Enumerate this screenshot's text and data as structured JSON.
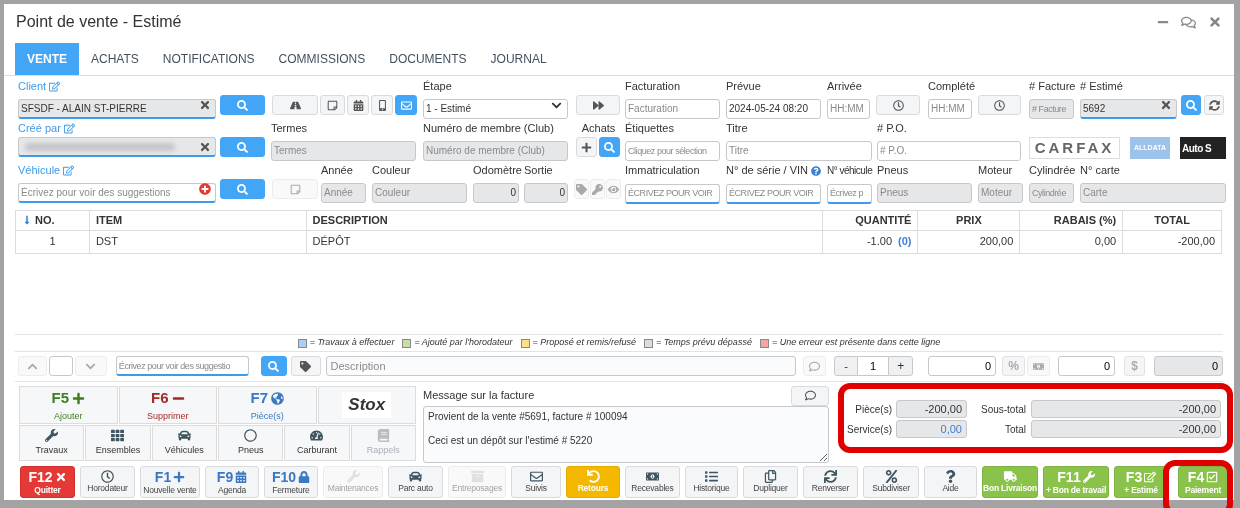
{
  "window": {
    "title": "Point de vente - Estimé"
  },
  "tabs": [
    {
      "label": "VENTE",
      "selected": true
    },
    {
      "label": "ACHATS",
      "selected": false
    },
    {
      "label": "NOTIFICATIONS",
      "selected": false
    },
    {
      "label": "COMMISSIONS",
      "selected": false
    },
    {
      "label": "DOCUMENTS",
      "selected": false
    },
    {
      "label": "JOURNAL",
      "selected": false
    }
  ],
  "client_buttons": [
    {
      "selected": false
    },
    {
      "selected": false
    },
    {
      "selected": false
    },
    {
      "selected": false
    },
    {
      "selected": true
    }
  ],
  "fields": {
    "client": {
      "label": "Client",
      "value": "SFSDF - ALAIN ST-PIERRE",
      "disabled": true
    },
    "etape": {
      "label": "Étape",
      "value": "1 - Estimé",
      "disabled": false
    },
    "facturation": {
      "label": "Facturation",
      "placeholder": "Facturation",
      "disabled": false
    },
    "prevue": {
      "label": "Prévue",
      "value": "2024-05-24 08:20",
      "disabled": false
    },
    "arrivee": {
      "label": "Arrivée",
      "placeholder": "HH:MM",
      "disabled": false
    },
    "complete": {
      "label": "Complété",
      "placeholder": "HH:MM",
      "disabled": false
    },
    "facture": {
      "label": "# Facture",
      "placeholder": "# Facture",
      "disabled": true
    },
    "estime": {
      "label": "# Estimé",
      "value": "5692",
      "disabled": true
    },
    "cree_par": {
      "label": "Créé par",
      "disabled": true
    },
    "termes": {
      "label": "Termes",
      "placeholder": "Termes",
      "disabled": true
    },
    "membre": {
      "label": "Numéro de membre (Club)",
      "placeholder": "Numéro de membre (Club)",
      "disabled": true
    },
    "etiquettes": {
      "label": "Étiquettes",
      "placeholder": "Cliquez pour sélection",
      "disabled": false
    },
    "titre": {
      "label": "Titre",
      "placeholder": "Titre",
      "disabled": false
    },
    "po": {
      "label": "# P.O.",
      "placeholder": "# P.O.",
      "disabled": false
    },
    "vehicule": {
      "label": "Véhicule",
      "placeholder": "Écrivez pour voir des suggestions",
      "disabled": false
    },
    "annee": {
      "label": "Année",
      "placeholder": "Année",
      "disabled": true
    },
    "couleur": {
      "label": "Couleur",
      "placeholder": "Couleur",
      "disabled": true
    },
    "odometre": {
      "label": "Odomètre",
      "value": "0",
      "disabled": true
    },
    "sortie": {
      "label": "Sortie",
      "value": "0",
      "disabled": true
    },
    "immatriculation": {
      "label": "Immatriculation",
      "placeholder": "ÉCRIVEZ POUR VOIR",
      "disabled": false
    },
    "vin": {
      "label": "N° de série / VIN",
      "placeholder": "ÉCRIVEZ POUR VOIR",
      "disabled": false
    },
    "no_vehicule": {
      "label": "N° véhicule",
      "placeholder": "Écrivez p",
      "disabled": false
    },
    "pneus": {
      "label": "Pneus",
      "placeholder": "Pneus",
      "disabled": true
    },
    "moteur": {
      "label": "Moteur",
      "placeholder": "Moteur",
      "disabled": true
    },
    "cylindree": {
      "label": "Cylindrée",
      "placeholder": "Cylindrée",
      "disabled": true
    },
    "carte": {
      "label": "N° carte",
      "placeholder": "Carte",
      "disabled": true
    }
  },
  "achats_label": "Achats",
  "logos": [
    "CARFAX",
    "ALLDATA",
    "Auto S"
  ],
  "table": {
    "columns": [
      "NO.",
      "ITEM",
      "DESCRIPTION",
      "QUANTITÉ",
      "PRIX",
      "RABAIS (%)",
      "TOTAL"
    ],
    "rows": [
      {
        "no": "1",
        "item": "DST",
        "description": "DÉPÔT",
        "quantity": "-1.00",
        "count": "(0)",
        "price": "200,00",
        "discount": "0,00",
        "total": "-200,00"
      }
    ]
  },
  "legend": [
    {
      "label": "= Travaux à effectuer",
      "color": "#a9d0f5"
    },
    {
      "label": "= Ajouté par l'horodateur",
      "color": "#c5e0a5"
    },
    {
      "label": "= Proposé et remis/refusé",
      "color": "#fbe08a"
    },
    {
      "label": "= Temps prévu dépassé",
      "color": "#dcdcdc"
    },
    {
      "label": "= Une erreur est présente dans cette ligne",
      "color": "#f4a6a6"
    }
  ],
  "entry": {
    "search_placeholder": "Écrivez pour voir des suggestio",
    "description_placeholder": "Description",
    "quantity": "1",
    "minus": "-",
    "plus": "+",
    "percent_value": "0",
    "percent_sign": "%",
    "amount_value": "0",
    "dollar_sign": "$",
    "price_value": "0"
  },
  "actions": [
    {
      "key": "F5",
      "label": "Ajouter",
      "kind": "add"
    },
    {
      "key": "F6",
      "label": "Supprimer",
      "kind": "remove"
    },
    {
      "key": "F7",
      "label": "Pièce(s)",
      "kind": "parts"
    },
    {
      "label": "Stox",
      "kind": "logo"
    }
  ],
  "categories": [
    {
      "label": "Travaux",
      "disabled": false
    },
    {
      "label": "Ensembles",
      "disabled": false
    },
    {
      "label": "Véhicules",
      "disabled": false
    },
    {
      "label": "Pneus",
      "disabled": false
    },
    {
      "label": "Carburant",
      "disabled": false
    },
    {
      "label": "Rappels",
      "disabled": true
    }
  ],
  "message": {
    "label": "Message sur la facture",
    "text": "Provient de la vente #5691, facture # 100094\n\nCeci est un dépôt sur l'estimé # 5220"
  },
  "totals_left": [
    {
      "label": "Pièce(s)",
      "value": "-200,00",
      "link": false
    },
    {
      "label": "Service(s)",
      "value": "0,00",
      "link": true
    }
  ],
  "totals_right": [
    {
      "label": "Sous-total",
      "value": "-200,00"
    },
    {
      "label": "Total",
      "value": "-200,00"
    }
  ],
  "bottom_buttons": [
    {
      "key": "F12",
      "label": "Quitter",
      "kind": "danger",
      "disabled": false
    },
    {
      "label": "Horodateur",
      "kind": "default",
      "disabled": false
    },
    {
      "key": "F1",
      "label": "Nouvelle vente",
      "kind": "default",
      "disabled": false
    },
    {
      "key": "F9",
      "label": "Agenda",
      "kind": "default",
      "disabled": false
    },
    {
      "key": "F10",
      "label": "Fermeture",
      "kind": "default",
      "disabled": false
    },
    {
      "label": "Maintenances",
      "kind": "default",
      "disabled": true
    },
    {
      "label": "Parc auto",
      "kind": "default",
      "disabled": false
    },
    {
      "label": "Entreposages",
      "kind": "default",
      "disabled": true
    },
    {
      "label": "Suivis",
      "kind": "default",
      "disabled": false
    },
    {
      "label": "Retours",
      "kind": "warning",
      "disabled": false
    },
    {
      "label": "Recevables",
      "kind": "default",
      "disabled": false
    },
    {
      "label": "Historique",
      "kind": "default",
      "disabled": false
    },
    {
      "label": "Dupliquer",
      "kind": "default",
      "disabled": false
    },
    {
      "label": "Renverser",
      "kind": "default",
      "disabled": false
    },
    {
      "label": "Subdiviser",
      "kind": "default",
      "disabled": false
    },
    {
      "label": "Aide",
      "kind": "default",
      "disabled": false
    },
    {
      "label": "Bon Livraison",
      "kind": "success",
      "disabled": false
    },
    {
      "key": "F11",
      "label": "+ Bon de travail",
      "kind": "success",
      "disabled": false
    },
    {
      "key": "F3",
      "label": "+ Estimé",
      "kind": "success",
      "disabled": false
    },
    {
      "key": "F4",
      "label": "Paiement",
      "kind": "success",
      "disabled": false
    }
  ]
}
